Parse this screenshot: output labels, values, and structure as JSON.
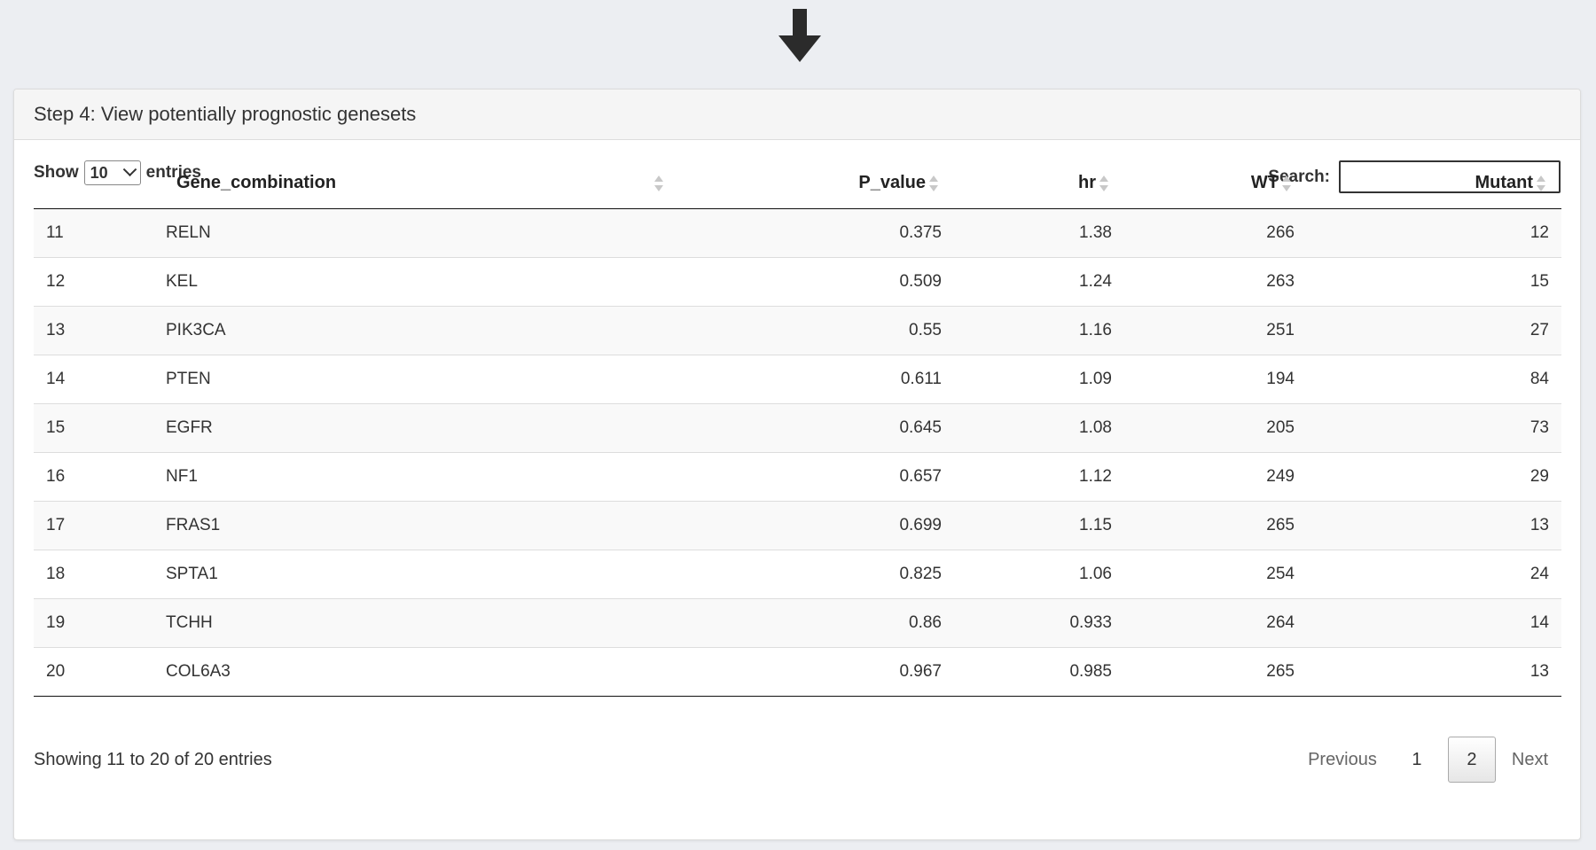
{
  "panel": {
    "title": "Step 4: View potentially prognostic genesets"
  },
  "controls": {
    "show_label": "Show",
    "entries_label": "entries",
    "page_length": "10",
    "search_label": "Search:",
    "search_value": ""
  },
  "table": {
    "headers": {
      "index": "",
      "gene": "Gene_combination",
      "p_value": "P_value",
      "hr": "hr",
      "wt": "WT",
      "mutant": "Mutant"
    },
    "rows": [
      {
        "idx": "11",
        "gene": "RELN",
        "p": "0.375",
        "hr": "1.38",
        "wt": "266",
        "mut": "12"
      },
      {
        "idx": "12",
        "gene": "KEL",
        "p": "0.509",
        "hr": "1.24",
        "wt": "263",
        "mut": "15"
      },
      {
        "idx": "13",
        "gene": "PIK3CA",
        "p": "0.55",
        "hr": "1.16",
        "wt": "251",
        "mut": "27"
      },
      {
        "idx": "14",
        "gene": "PTEN",
        "p": "0.611",
        "hr": "1.09",
        "wt": "194",
        "mut": "84"
      },
      {
        "idx": "15",
        "gene": "EGFR",
        "p": "0.645",
        "hr": "1.08",
        "wt": "205",
        "mut": "73"
      },
      {
        "idx": "16",
        "gene": "NF1",
        "p": "0.657",
        "hr": "1.12",
        "wt": "249",
        "mut": "29"
      },
      {
        "idx": "17",
        "gene": "FRAS1",
        "p": "0.699",
        "hr": "1.15",
        "wt": "265",
        "mut": "13"
      },
      {
        "idx": "18",
        "gene": "SPTA1",
        "p": "0.825",
        "hr": "1.06",
        "wt": "254",
        "mut": "24"
      },
      {
        "idx": "19",
        "gene": "TCHH",
        "p": "0.86",
        "hr": "0.933",
        "wt": "264",
        "mut": "14"
      },
      {
        "idx": "20",
        "gene": "COL6A3",
        "p": "0.967",
        "hr": "0.985",
        "wt": "265",
        "mut": "13"
      }
    ]
  },
  "footer": {
    "info": "Showing 11 to 20 of 20 entries",
    "previous": "Previous",
    "pages": [
      "1",
      "2"
    ],
    "current_page": "2",
    "next": "Next"
  },
  "icons": {
    "top_arrow": "arrow-down-icon",
    "sort": "sort-both-icon"
  }
}
